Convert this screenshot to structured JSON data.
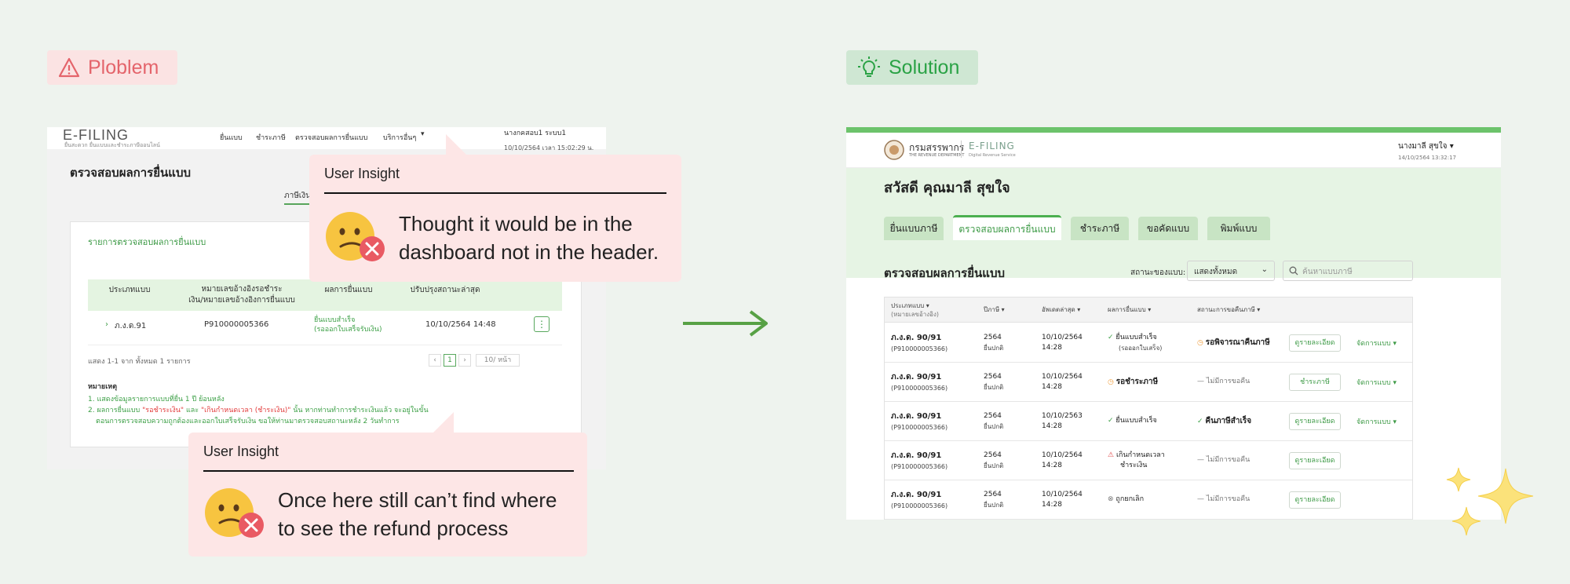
{
  "problem_tag": {
    "label": "Ploblem",
    "icon": "warning-triangle-icon",
    "color": "#e4646b"
  },
  "solution_tag": {
    "label": "Solution",
    "icon": "lightbulb-icon",
    "color": "#2aa245"
  },
  "old_screen": {
    "logo": "E-FILING",
    "logo_sub": "ยื่นสะดวก ยื่นแบบและชำระภาษีออนไลน์",
    "nav": [
      "ยื่นแบบ",
      "ชำระภาษี",
      "ตรวจสอบผลการยื่นแบบ",
      "บริการอื่นๆ"
    ],
    "user": "นางกคสอบ1 ระบบ1",
    "datetime": "10/10/2564 เวลา 15:02:29 น.",
    "page_title": "ตรวจสอบผลการยื่นแบบ",
    "tab_fragment": "ภาษีเงิน",
    "card_title": "รายการตรวจสอบผลการยื่นแบบ",
    "columns": [
      "ประเภทแบบ",
      "หมายเลขอ้างอิงรอชำระ\nเงิน/หมายเลขอ้างอิงการยื่นแบบ",
      "ผลการยื่นแบบ",
      "ปรับปรุงสถานะล่าสุด"
    ],
    "row": {
      "form": "ภ.ง.ด.91",
      "ref": "P910000005366",
      "result": "ยื่นแบบสำเร็จ",
      "result_sub": "(รอออกใบเสร็จรับเงิน)",
      "updated": "10/10/2564 14:48"
    },
    "pager_info": "แสดง 1-1 จาก ทั้งหมด 1 รายการ",
    "page_number": "1",
    "per_page": "10/ หน้า",
    "notes_heading": "หมายเหตุ",
    "note1": "1. แสดงข้อมูลรายการแบบที่ยื่น 1 ปี ย้อนหลัง",
    "note2_a": "2. ผลการยื่นแบบ ",
    "note2_b": "\"รอชำระเงิน\"",
    "note2_c": " และ ",
    "note2_d": "\"เกินกำหนดเวลา (ชำระเงิน)\"",
    "note2_e": " นั้น หากท่านทำการชำระเงินแล้ว จะอยู่ในขั้น",
    "note3": "ตอนการตรวจสอบความถูกต้องและออกใบเสร็จรับเงิน ขอให้ท่านมาตรวจสอบสถานะหลัง 2 วันทำการ"
  },
  "insight1": {
    "label": "User Insight",
    "text": "Thought it would be in the dashboard not in the header."
  },
  "insight2": {
    "label": "User Insight",
    "text": "Once here still can’t find where to see the refund process"
  },
  "new_screen": {
    "org_name": "กรมสรรพากร",
    "org_sub": "THE REVENUE DEPARTMENT",
    "efiling": "E-FILING",
    "efiling_sub": "Digital Revenue Service",
    "user": "นางมาลี สุขใจ",
    "datetime": "14/10/2564  13:32:17",
    "greeting": "สวัสดี คุณมาลี สุขใจ",
    "tabs": [
      "ยื่นแบบภาษี",
      "ตรวจสอบผลการยื่นแบบ",
      "ชำระภาษี",
      "ขอคัดแบบ",
      "พิมพ์แบบ"
    ],
    "section_title": "ตรวจสอบผลการยื่นแบบ",
    "filter_label": "สถานะของแบบ:",
    "filter_value": "แสดงทั้งหมด",
    "search_placeholder": "ค้นหาแบบภาษี",
    "columns": [
      "ประเภทแบบ ▾",
      "(หมายเลขอ้างอิง)",
      "ปีภาษี ▾",
      "อัพเดตล่าสุด ▾",
      "ผลการยื่นแบบ ▾",
      "สถานะการขอคืนภาษี ▾"
    ],
    "rows": [
      {
        "form": "ภ.ง.ด. 90/91",
        "ref": "(P910000005366)",
        "year": "2564",
        "type": "ยื่นปกติ",
        "date": "10/10/2564",
        "time": "14:28",
        "result": "ยื่นแบบสำเร็จ",
        "result_sub": "(รอออกใบเสร็จ)",
        "refund": "รอพิจารณาคืนภาษี",
        "action": "ดูรายละเอียด",
        "manage": "จัดการแบบ ▾"
      },
      {
        "form": "ภ.ง.ด. 90/91",
        "ref": "(P910000005366)",
        "year": "2564",
        "type": "ยื่นปกติ",
        "date": "10/10/2564",
        "time": "14:28",
        "result": "รอชำระภาษี",
        "result_sub": "",
        "refund": "ไม่มีการขอคืน",
        "action": "ชำระภาษี",
        "manage": "จัดการแบบ ▾"
      },
      {
        "form": "ภ.ง.ด. 90/91",
        "ref": "(P910000005366)",
        "year": "2564",
        "type": "ยื่นปกติ",
        "date": "10/10/2563",
        "time": "14:28",
        "result": "ยื่นแบบสำเร็จ",
        "result_sub": "",
        "refund": "คืนภาษีสำเร็จ",
        "action": "ดูรายละเอียด",
        "manage": "จัดการแบบ ▾"
      },
      {
        "form": "ภ.ง.ด. 90/91",
        "ref": "(P910000005366)",
        "year": "2564",
        "type": "ยื่นปกติ",
        "date": "10/10/2564",
        "time": "14:28",
        "result": "เกินกำหนดเวลา",
        "result_sub": "ชำระเงิน",
        "refund": "ไม่มีการขอคืน",
        "action": "ดูรายละเอียด",
        "manage": ""
      },
      {
        "form": "ภ.ง.ด. 90/91",
        "ref": "(P910000005366)",
        "year": "2564",
        "type": "ยื่นปกติ",
        "date": "10/10/2564",
        "time": "14:28",
        "result": "ถูกยกเลิก",
        "result_sub": "",
        "refund": "ไม่มีการขอคืน",
        "action": "ดูรายละเอียด",
        "manage": ""
      }
    ],
    "accent": "#4caf50"
  }
}
